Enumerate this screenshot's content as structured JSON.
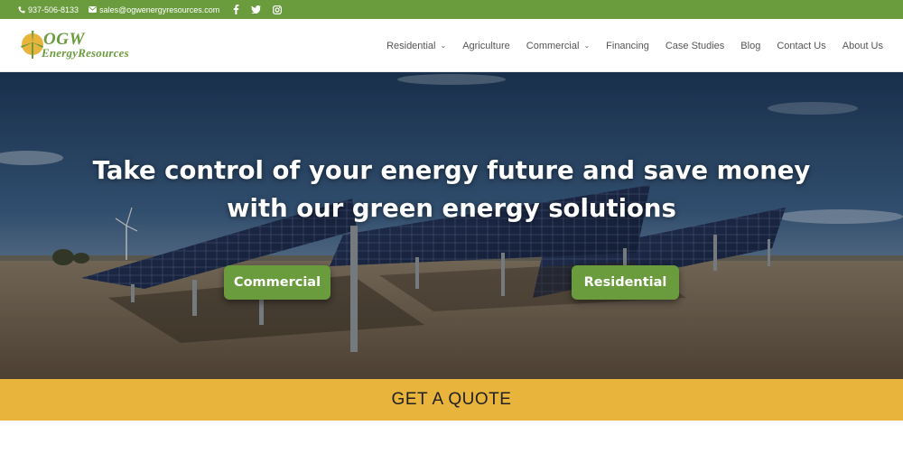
{
  "topbar": {
    "phone": "937-506-8133",
    "email": "sales@ogwenergyresources.com",
    "social": [
      "facebook-icon",
      "twitter-icon",
      "instagram-icon"
    ]
  },
  "logo": {
    "line1": "OGW",
    "line2": "EnergyResources"
  },
  "nav": {
    "items": [
      {
        "label": "Residential",
        "dropdown": true
      },
      {
        "label": "Agriculture",
        "dropdown": false
      },
      {
        "label": "Commercial",
        "dropdown": true
      },
      {
        "label": "Financing",
        "dropdown": false
      },
      {
        "label": "Case Studies",
        "dropdown": false
      },
      {
        "label": "Blog",
        "dropdown": false
      },
      {
        "label": "Contact Us",
        "dropdown": false
      },
      {
        "label": "About Us",
        "dropdown": false
      }
    ]
  },
  "hero": {
    "headline_line1": "Take control of your energy future and save money",
    "headline_line2": "with our green energy solutions",
    "button_commercial": "Commercial",
    "button_residential": "Residential"
  },
  "quote": {
    "label": "GET A QUOTE"
  },
  "colors": {
    "brand_green": "#6a9b3d",
    "quote_yellow": "#e9b43c"
  }
}
